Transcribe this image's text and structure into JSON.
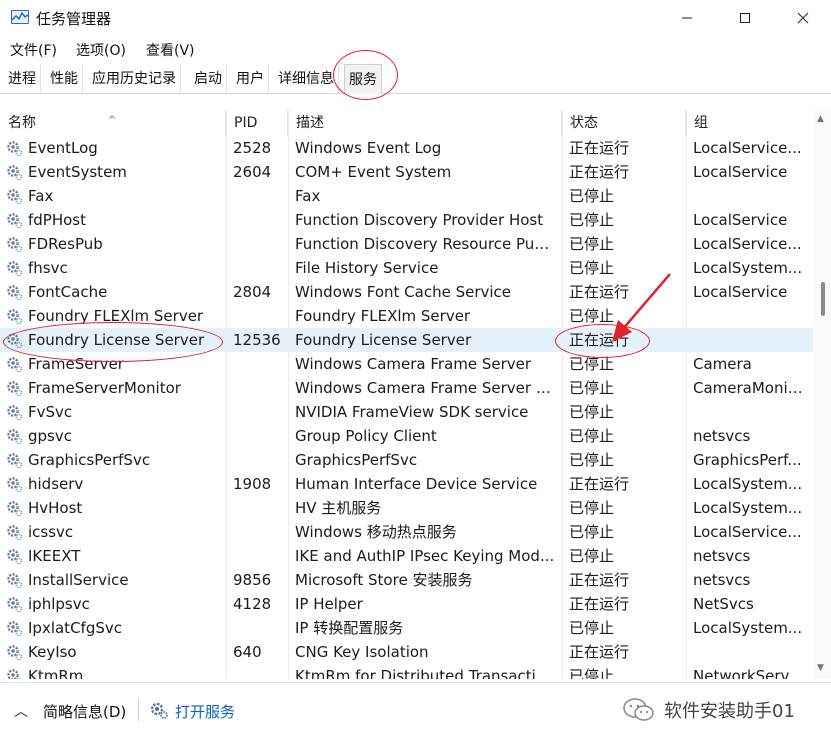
{
  "window": {
    "title": "任务管理器"
  },
  "menu": [
    "文件(F)",
    "选项(O)",
    "查看(V)"
  ],
  "tabs": [
    {
      "label": "进程",
      "active": false
    },
    {
      "label": "性能",
      "active": false
    },
    {
      "label": "应用历史记录",
      "active": false
    },
    {
      "label": "启动",
      "active": false
    },
    {
      "label": "用户",
      "active": false
    },
    {
      "label": "详细信息",
      "active": false
    },
    {
      "label": "服务",
      "active": true
    }
  ],
  "columns": [
    "名称",
    "PID",
    "描述",
    "状态",
    "组"
  ],
  "rows": [
    {
      "name": "EventLog",
      "pid": "2528",
      "desc": "Windows Event Log",
      "status": "正在运行",
      "group": "LocalService..."
    },
    {
      "name": "EventSystem",
      "pid": "2604",
      "desc": "COM+ Event System",
      "status": "正在运行",
      "group": "LocalService"
    },
    {
      "name": "Fax",
      "pid": "",
      "desc": "Fax",
      "status": "已停止",
      "group": ""
    },
    {
      "name": "fdPHost",
      "pid": "",
      "desc": "Function Discovery Provider Host",
      "status": "已停止",
      "group": "LocalService"
    },
    {
      "name": "FDResPub",
      "pid": "",
      "desc": "Function Discovery Resource Publ...",
      "status": "已停止",
      "group": "LocalService..."
    },
    {
      "name": "fhsvc",
      "pid": "",
      "desc": "File History Service",
      "status": "已停止",
      "group": "LocalSystem..."
    },
    {
      "name": "FontCache",
      "pid": "2804",
      "desc": "Windows Font Cache Service",
      "status": "正在运行",
      "group": "LocalService"
    },
    {
      "name": "Foundry FLEXlm Server",
      "pid": "",
      "desc": "Foundry FLEXlm Server",
      "status": "已停止",
      "group": ""
    },
    {
      "name": "Foundry License Server",
      "pid": "12536",
      "desc": "Foundry License Server",
      "status": "正在运行",
      "group": "",
      "selected": true
    },
    {
      "name": "FrameServer",
      "pid": "",
      "desc": "Windows Camera Frame Server",
      "status": "已停止",
      "group": "Camera"
    },
    {
      "name": "FrameServerMonitor",
      "pid": "",
      "desc": "Windows Camera Frame Server M...",
      "status": "已停止",
      "group": "CameraMonit..."
    },
    {
      "name": "FvSvc",
      "pid": "",
      "desc": "NVIDIA FrameView SDK service",
      "status": "已停止",
      "group": ""
    },
    {
      "name": "gpsvc",
      "pid": "",
      "desc": "Group Policy Client",
      "status": "已停止",
      "group": "netsvcs"
    },
    {
      "name": "GraphicsPerfSvc",
      "pid": "",
      "desc": "GraphicsPerfSvc",
      "status": "已停止",
      "group": "GraphicsPerf..."
    },
    {
      "name": "hidserv",
      "pid": "1908",
      "desc": "Human Interface Device Service",
      "status": "正在运行",
      "group": "LocalSystem..."
    },
    {
      "name": "HvHost",
      "pid": "",
      "desc": "HV 主机服务",
      "status": "已停止",
      "group": "LocalSystem..."
    },
    {
      "name": "icssvc",
      "pid": "",
      "desc": "Windows 移动热点服务",
      "status": "已停止",
      "group": "LocalService..."
    },
    {
      "name": "IKEEXT",
      "pid": "",
      "desc": "IKE and AuthIP IPsec Keying Mod...",
      "status": "已停止",
      "group": "netsvcs"
    },
    {
      "name": "InstallService",
      "pid": "9856",
      "desc": "Microsoft Store 安装服务",
      "status": "正在运行",
      "group": "netsvcs"
    },
    {
      "name": "iphlpsvc",
      "pid": "4128",
      "desc": "IP Helper",
      "status": "正在运行",
      "group": "NetSvcs"
    },
    {
      "name": "IpxlatCfgSvc",
      "pid": "",
      "desc": "IP 转换配置服务",
      "status": "已停止",
      "group": "LocalSystem..."
    },
    {
      "name": "KeyIso",
      "pid": "640",
      "desc": "CNG Key Isolation",
      "status": "正在运行",
      "group": ""
    },
    {
      "name": "KtmRm",
      "pid": "",
      "desc": "KtmRm for Distributed Transactio...",
      "status": "已停止",
      "group": "NetworkServi..."
    }
  ],
  "footer": {
    "fewer_details": "简略信息(D)",
    "open_services": "打开服务"
  },
  "watermark": "软件安装助手01",
  "colors": {
    "selection": "#e5f1fb",
    "annotation": "#e0242e",
    "link": "#0b61c4"
  }
}
